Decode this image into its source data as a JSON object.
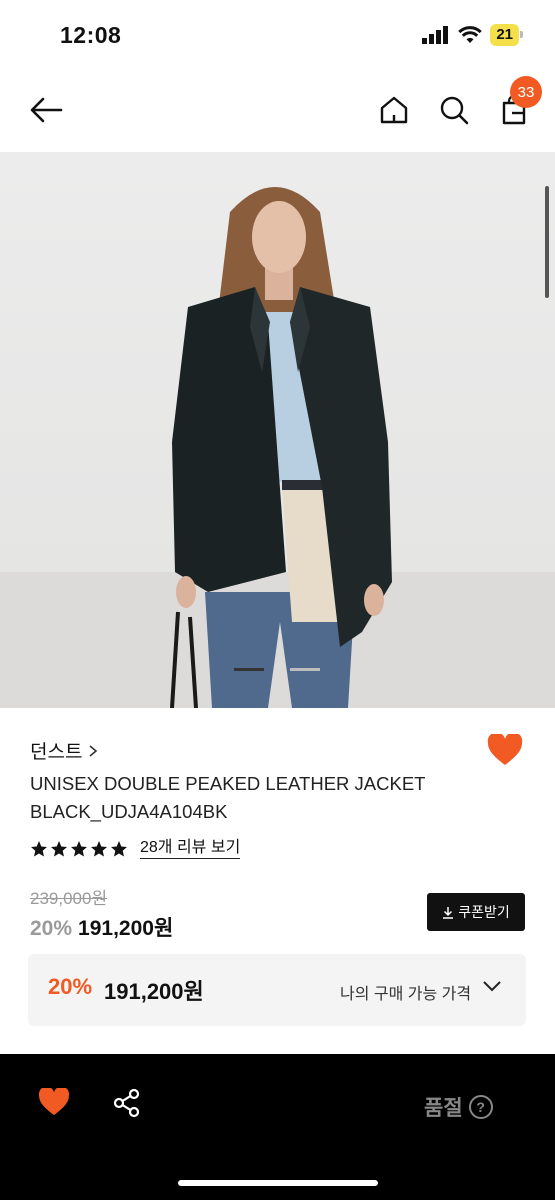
{
  "status_bar": {
    "time": "12:08",
    "battery": "21"
  },
  "header": {
    "cart_count": "33"
  },
  "product": {
    "brand": "던스트",
    "name_line1": "UNISEX DOUBLE PEAKED LEATHER JACKET",
    "name_line2": "BLACK_UDJA4A104BK",
    "rating_stars": 5,
    "review_link": "28개 리뷰 보기",
    "original_price": "239,000원",
    "discount": "20%",
    "sale_price": "191,200원",
    "coupon_button": "쿠폰받기"
  },
  "my_price": {
    "discount": "20%",
    "price": "191,200원",
    "label": "나의 구매 가능 가격"
  },
  "carousel": {
    "pages": 2,
    "active": 0
  },
  "bottom_bar": {
    "status": "품절",
    "help": "?"
  },
  "colors": {
    "accent": "#f15a22",
    "dark": "#000000"
  }
}
